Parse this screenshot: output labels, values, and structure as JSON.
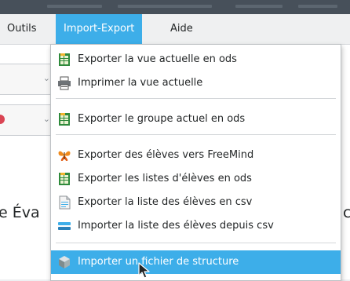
{
  "menubar": {
    "items": [
      "Outils",
      "Import-Export",
      "Aide"
    ],
    "active_index": 1
  },
  "background": {
    "text_left": "e Éva",
    "text_right": "c"
  },
  "dropdown": {
    "items": [
      {
        "label": "Exporter la vue actuelle en ods",
        "icon": "spreadsheet-icon"
      },
      {
        "label": "Imprimer la vue actuelle",
        "icon": "printer-icon"
      },
      {
        "label": "Exporter le groupe actuel en ods",
        "icon": "spreadsheet-icon"
      },
      {
        "label": "Exporter des élèves vers FreeMind",
        "icon": "freemind-butterfly-icon"
      },
      {
        "label": "Exporter les listes d'élèves en ods",
        "icon": "spreadsheet-icon"
      },
      {
        "label": "Exporter la liste des élèves en csv",
        "icon": "csv-file-icon"
      },
      {
        "label": "Importer la liste des élèves depuis csv",
        "icon": "import-list-icon"
      },
      {
        "label": "Importer un fichier de structure",
        "icon": "structure-file-icon",
        "highlighted": true
      }
    ]
  },
  "colors": {
    "accent": "#3daee9",
    "titlebar": "#47505a",
    "menu_bg": "#ffffff",
    "text": "#232627",
    "red_mark": "#da4453"
  }
}
